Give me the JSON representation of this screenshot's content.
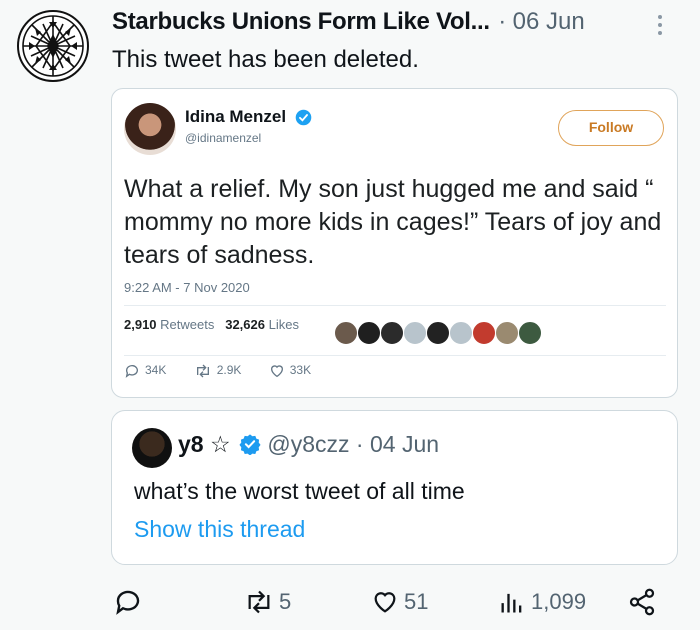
{
  "tweet": {
    "author": "Starbucks Unions Form Like Vol...",
    "separator": "·",
    "date": "06 Jun",
    "body": "This tweet has been deleted."
  },
  "screenshot": {
    "name": "Idina Menzel",
    "handle": "@idinamenzel",
    "follow_label": "Follow",
    "text": "What a relief.  My son just hugged me and said “ mommy no more kids in cages!” Tears of joy and tears of sadness.",
    "timestamp": "9:22 AM - 7 Nov 2020",
    "retweets_count": "2,910",
    "retweets_label": "Retweets",
    "likes_count": "32,626",
    "likes_label": "Likes",
    "replies": "34K",
    "retweets": "2.9K",
    "likes": "33K",
    "verified_color": "#1da1f2",
    "follow_color": "#e0a45a"
  },
  "quote": {
    "name": "y8 ☆",
    "handle": "@y8czz",
    "separator": "·",
    "date": "04 Jun",
    "text": "what’s the worst tweet of all time",
    "show_thread": "Show this thread"
  },
  "actions": {
    "replies": "",
    "retweets": "5",
    "likes": "51",
    "views": "1,099"
  },
  "colors": {
    "background": "#f7f9f9",
    "link": "#1d9bf0",
    "secondary_text": "#536471"
  }
}
